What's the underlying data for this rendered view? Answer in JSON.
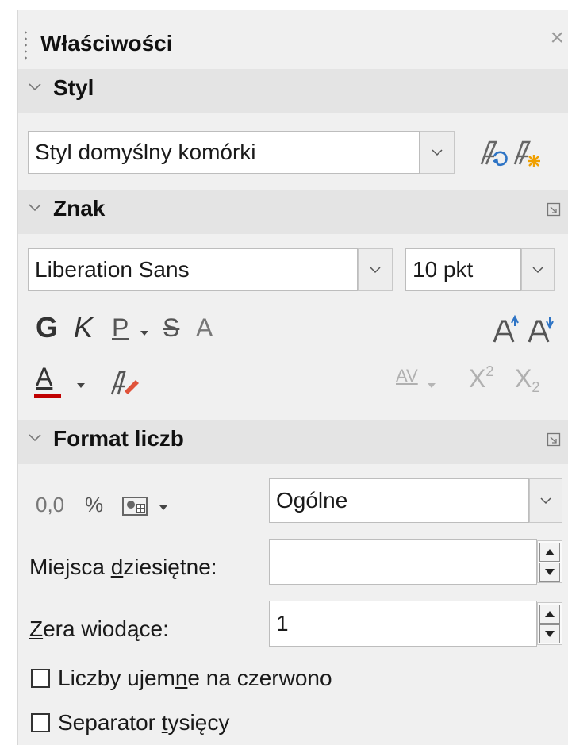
{
  "panel": {
    "title": "Właściwości",
    "close": "×"
  },
  "styl": {
    "header": "Styl",
    "style_value": "Styl domyślny komórki"
  },
  "znak": {
    "header": "Znak",
    "font_name": "Liberation Sans",
    "font_size": "10 pkt",
    "bold": "G",
    "italic": "K",
    "underline": "P",
    "strike": "S",
    "shadow": "A",
    "font_color": "A",
    "spacing": "AV",
    "superscript": "X",
    "superscript_mark": "2",
    "subscript": "X",
    "subscript_mark": "2"
  },
  "format": {
    "header": "Format liczb",
    "decimal_icon": "0,0",
    "percent_icon": "%",
    "category_value": "Ogólne",
    "decimal_places_label_pre": "Miejsca ",
    "decimal_places_label_u": "d",
    "decimal_places_label_post": "ziesiętne:",
    "decimal_places_value": "",
    "leading_zeros_label_u": "Z",
    "leading_zeros_label_post": "era wiodące:",
    "leading_zeros_value": "1",
    "negative_red_pre": "Liczby ujem",
    "negative_red_u": "n",
    "negative_red_post": "e na czerwono",
    "thousands_pre": "Separator ",
    "thousands_u": "t",
    "thousands_post": "ysięcy"
  },
  "colors": {
    "font_color_bar": "#c00000",
    "highlight": "#e0533a"
  }
}
